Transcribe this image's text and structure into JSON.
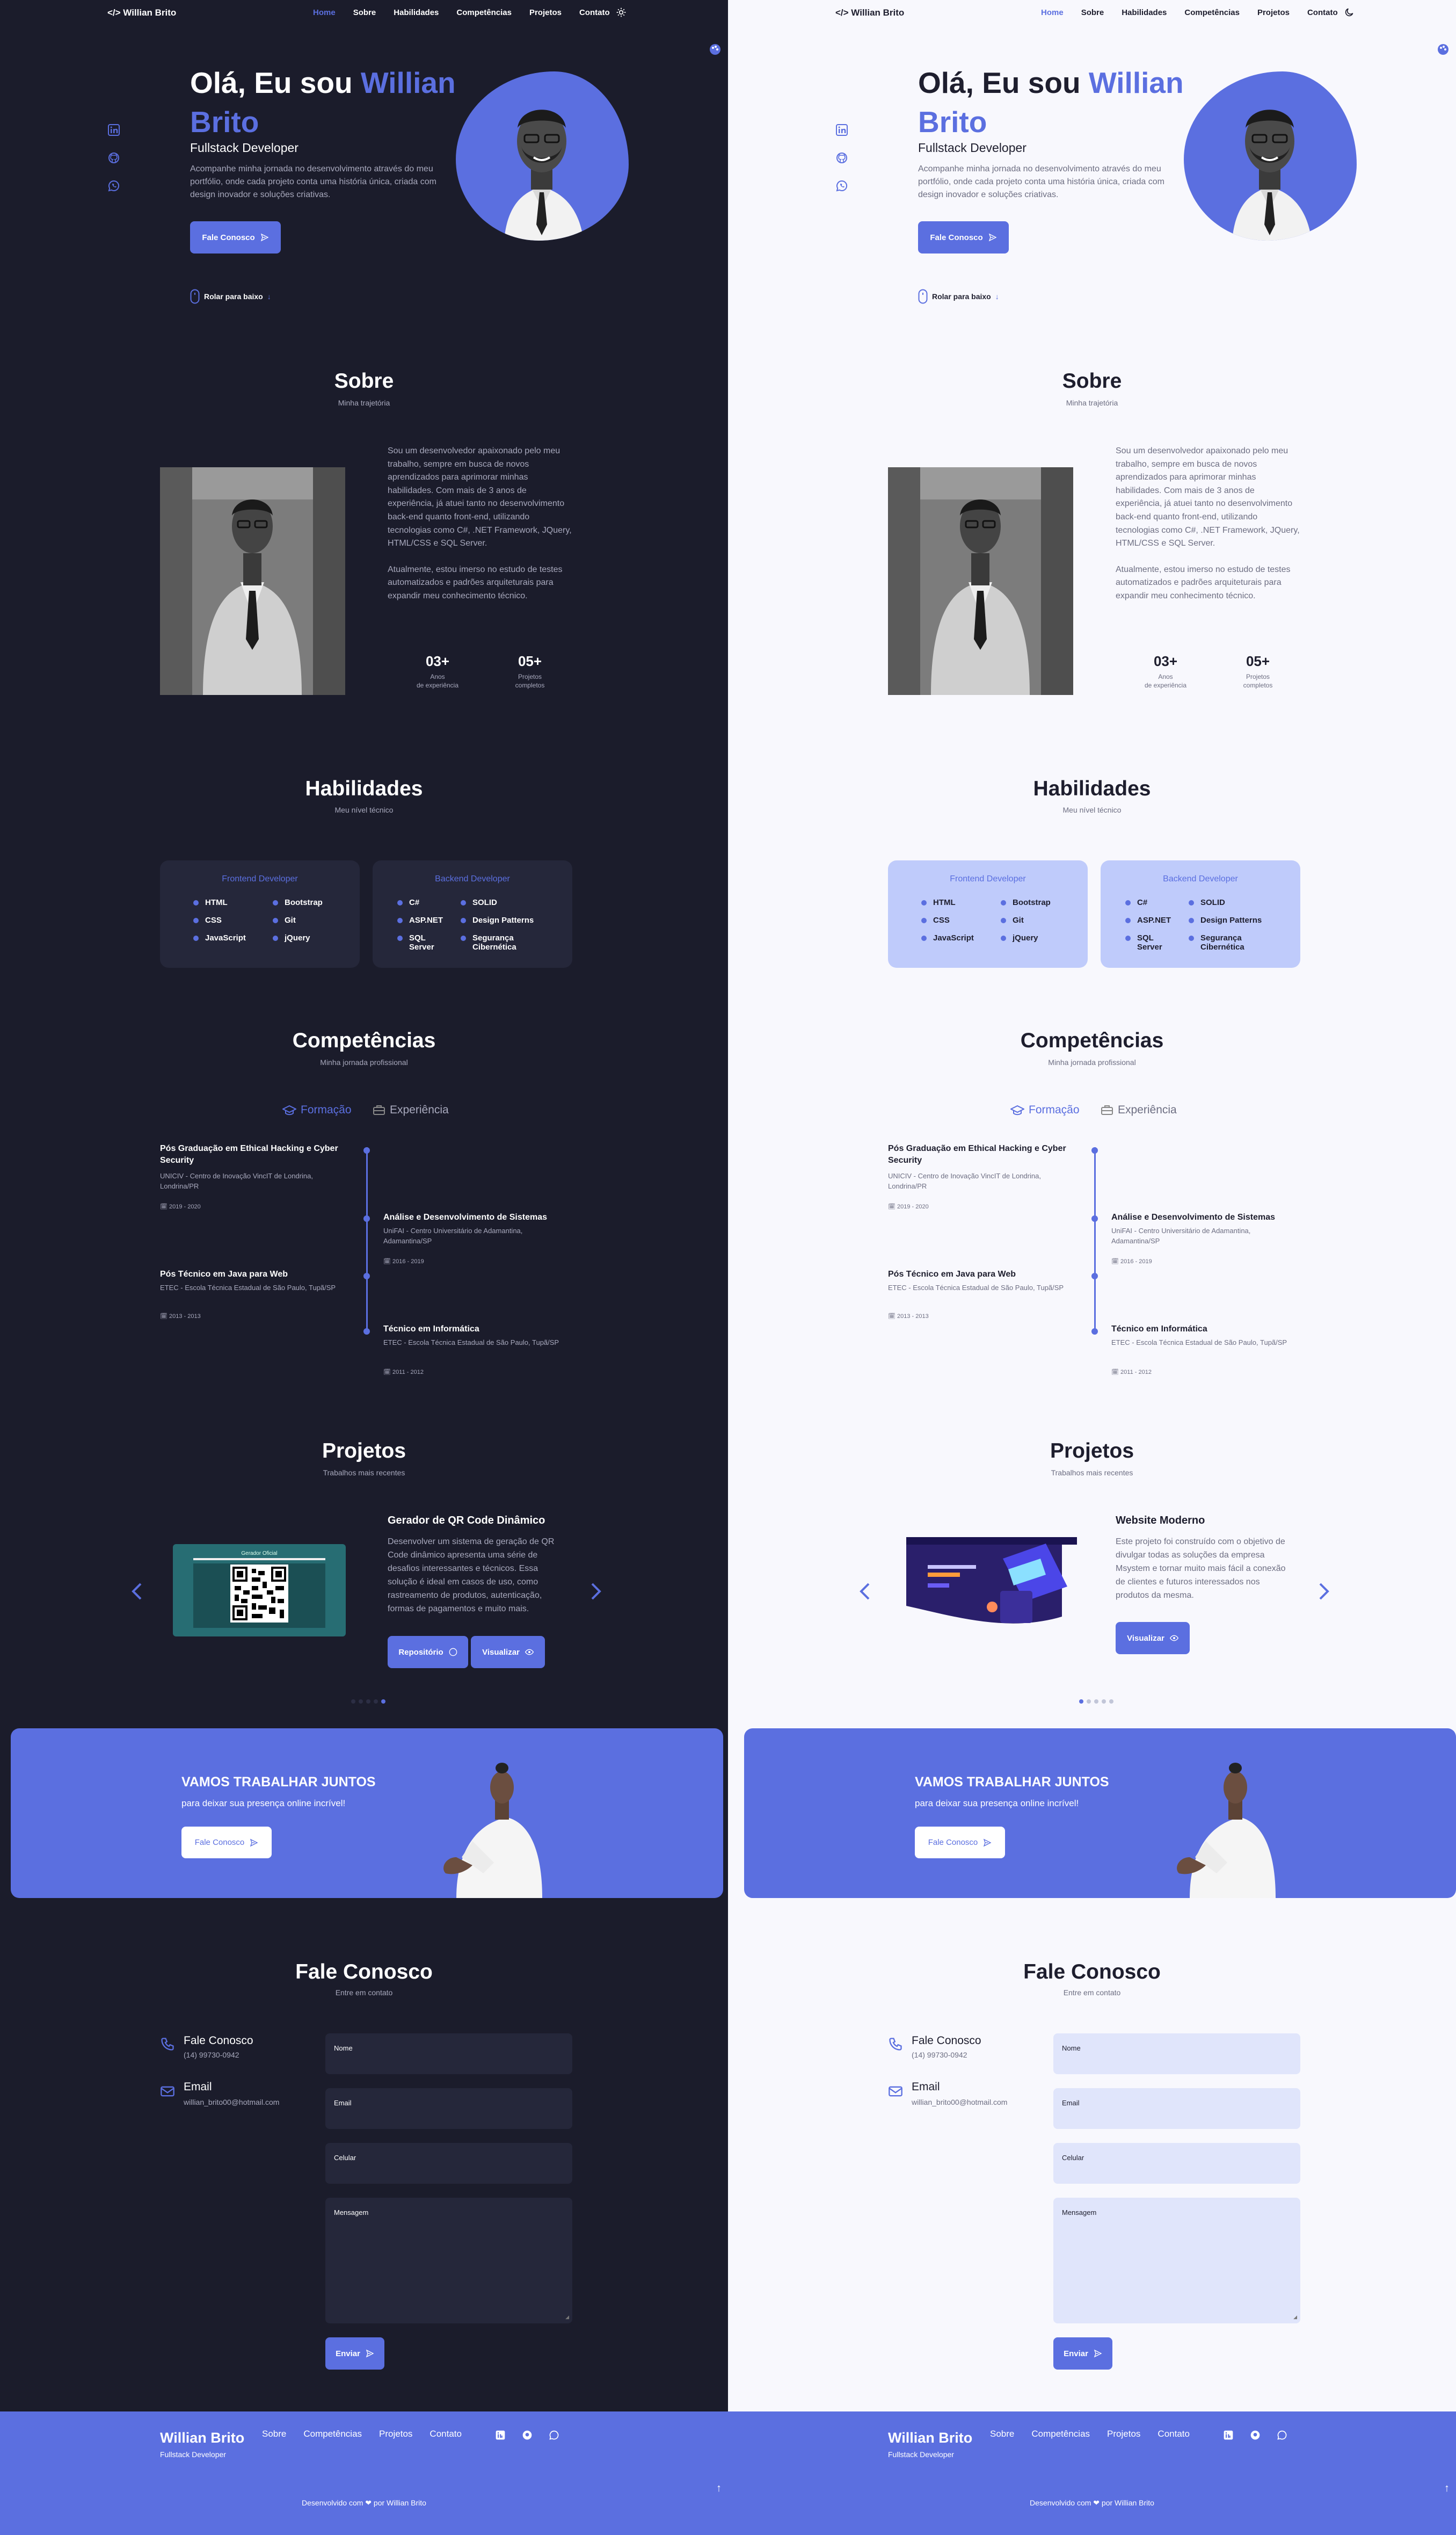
{
  "header": {
    "logo": "</> Willian Brito",
    "nav": [
      "Home",
      "Sobre",
      "Habilidades",
      "Competências",
      "Projetos",
      "Contato"
    ]
  },
  "hero": {
    "greeting": "Olá, Eu sou",
    "name": "Willian Brito",
    "role": "Fullstack Developer",
    "description": "Acompanhe minha jornada no desenvolvimento através do meu portfólio, onde cada projeto conta uma história única, criada com design inovador e soluções criativas.",
    "cta": "Fale Conosco",
    "scroll": "Rolar para baixo"
  },
  "about": {
    "title": "Sobre",
    "subtitle": "Minha trajetória",
    "p1": "Sou um desenvolvedor apaixonado pelo meu trabalho, sempre em busca de novos aprendizados para aprimorar minhas habilidades. Com mais de 3 anos de experiência, já atuei tanto no desenvolvimento back-end quanto front-end, utilizando tecnologias como C#, .NET Framework, JQuery, HTML/CSS e SQL Server.",
    "p2": "Atualmente, estou imerso no estudo de testes automatizados e padrões arquiteturais para expandir meu conhecimento técnico.",
    "stats": [
      {
        "n": "03+",
        "l1": "Anos",
        "l2": "de experiência"
      },
      {
        "n": "05+",
        "l1": "Projetos",
        "l2": "completos"
      }
    ]
  },
  "skills": {
    "title": "Habilidades",
    "subtitle": "Meu nível técnico",
    "frontend": {
      "title": "Frontend Developer",
      "items": [
        "HTML",
        "Bootstrap",
        "CSS",
        "Git",
        "JavaScript",
        "jQuery"
      ]
    },
    "backend": {
      "title": "Backend Developer",
      "items": [
        "C#",
        "SOLID",
        "ASP.NET",
        "Design Patterns",
        "SQL Server",
        "Segurança Cibernética"
      ]
    }
  },
  "qualifications": {
    "title": "Competências",
    "subtitle": "Minha jornada profissional",
    "tab_education": "Formação",
    "tab_experience": "Experiência",
    "items": [
      {
        "title": "Pós Graduação em Ethical Hacking e Cyber Security",
        "place": "UNICIV - Centro de Inovação VincIT de Londrina, Londrina/PR",
        "date": "2019 - 2020"
      },
      {
        "title": "Análise e Desenvolvimento de Sistemas",
        "place": "UniFAI - Centro Universitário de Adamantina, Adamantina/SP",
        "date": "2016 - 2019"
      },
      {
        "title": "Pós Técnico em Java para Web",
        "place": "ETEC - Escola Técnica Estadual de São Paulo, Tupã/SP",
        "date": "2013 - 2013"
      },
      {
        "title": "Técnico em Informática",
        "place": "ETEC - Escola Técnica Estadual de São Paulo, Tupã/SP",
        "date": "2011 - 2012"
      }
    ]
  },
  "projects": {
    "title": "Projetos",
    "subtitle": "Trabalhos mais recentes",
    "dark": {
      "title": "Gerador de QR Code Dinâmico",
      "desc": "Desenvolver um sistema de geração de QR Code dinâmico apresenta uma série de desafios interessantes e técnicos. Essa solução é ideal em casos de uso, como rastreamento de produtos, autenticação, formas de pagamentos e muito mais.",
      "btn_repo": "Repositório",
      "btn_view": "Visualizar",
      "image_caption": "Gerador Oficial"
    },
    "light": {
      "title": "Website Moderno",
      "desc": "Este projeto foi construído com o objetivo de divulgar todas as soluções da empresa Msystem e tornar muito mais fácil a conexão de clientes e futuros interessados nos produtos da mesma.",
      "btn_view": "Visualizar"
    }
  },
  "cta": {
    "title": "VAMOS TRABALHAR JUNTOS",
    "subtitle": "para deixar sua presença online incrível!",
    "button": "Fale Conosco"
  },
  "contact": {
    "title": "Fale Conosco",
    "subtitle": "Entre em contato",
    "phone_label": "Fale Conosco",
    "phone": "(14) 99730-0942",
    "email_label": "Email",
    "email": "willian_brito00@hotmail.com",
    "fields": [
      "Nome",
      "Email",
      "Celular",
      "Mensagem"
    ],
    "send": "Enviar"
  },
  "footer": {
    "name": "Willian Brito",
    "role": "Fullstack Developer",
    "links": [
      "Sobre",
      "Competências",
      "Projetos",
      "Contato"
    ],
    "copy": "Desenvolvido com ❤ por Willian Brito"
  },
  "colors": {
    "accent": "#5b6fe0",
    "dark_bg": "#1b1c2b",
    "light_bg": "#f8f8fd"
  }
}
